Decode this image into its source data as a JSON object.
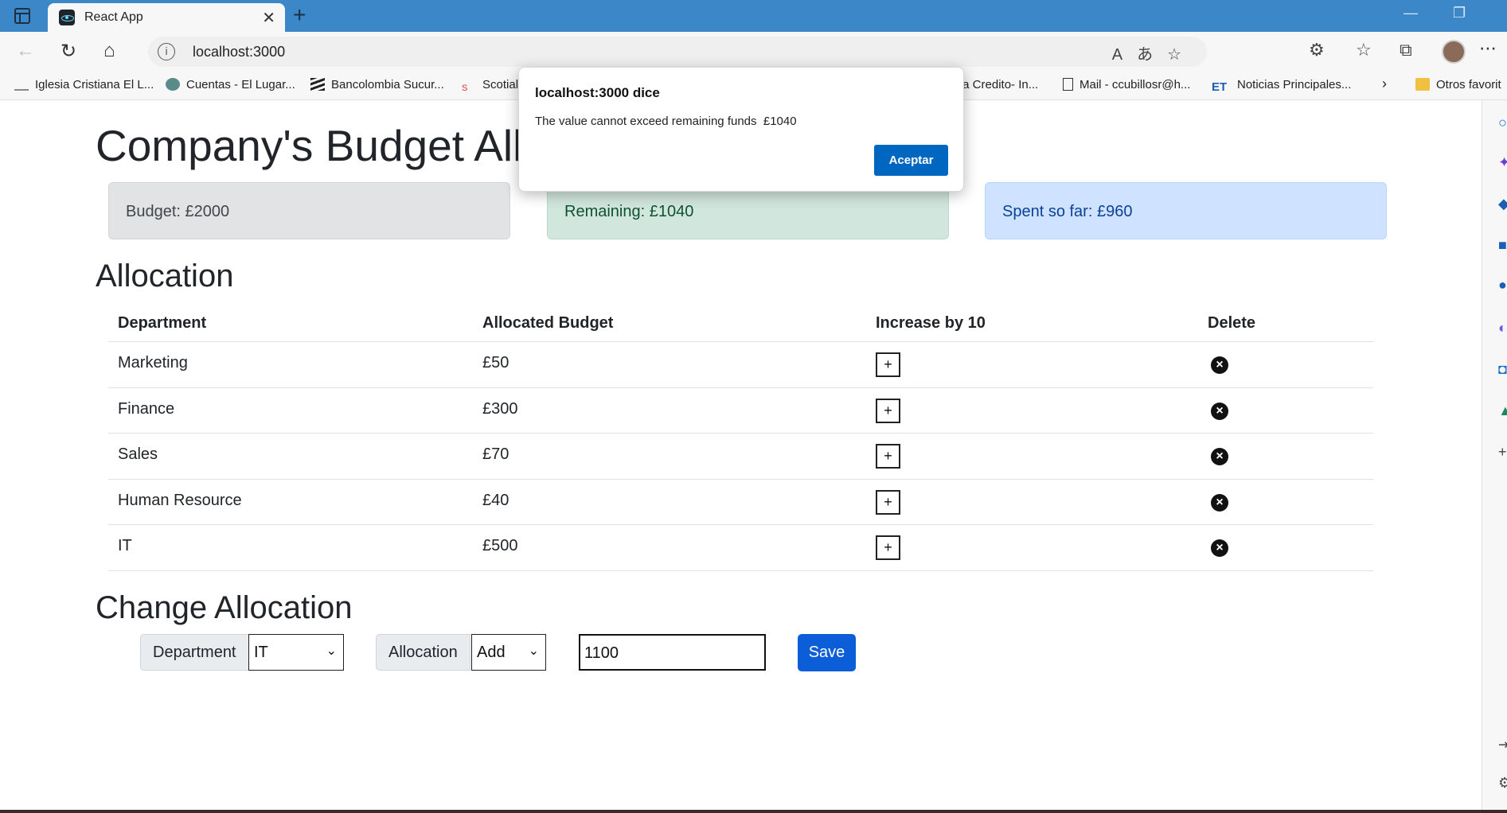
{
  "browser": {
    "tab_title": "React App",
    "url": "localhost:3000",
    "bookmarks": [
      "Iglesia Cristiana El L...",
      "Cuentas - El Lugar...",
      "Bancolombia Sucur...",
      "Scotial",
      "ta Credito- In...",
      "Mail - ccubillosr@h...",
      "Noticias Principales...",
      "Otros favorit"
    ]
  },
  "page": {
    "title": "Company's Budget Allocation",
    "cards": {
      "budget": "Budget: £2000",
      "remaining": "Remaining: £1040",
      "spent": "Spent so far: £960"
    },
    "allocation_heading": "Allocation",
    "table": {
      "headers": [
        "Department",
        "Allocated Budget",
        "Increase by 10",
        "Delete"
      ],
      "rows": [
        {
          "department": "Marketing",
          "budget": "£50"
        },
        {
          "department": "Finance",
          "budget": "£300"
        },
        {
          "department": "Sales",
          "budget": "£70"
        },
        {
          "department": "Human Resource",
          "budget": "£40"
        },
        {
          "department": "IT",
          "budget": "£500"
        }
      ],
      "plus_label": "+"
    },
    "change_heading": "Change Allocation",
    "form": {
      "department_label": "Department",
      "department_value": "IT",
      "allocation_label": "Allocation",
      "allocation_value": "Add",
      "amount_value": "1100",
      "save_label": "Save"
    }
  },
  "dialog": {
    "title": "localhost:3000 dice",
    "message": "The value cannot exceed remaining funds  £1040",
    "ok_label": "Aceptar"
  }
}
